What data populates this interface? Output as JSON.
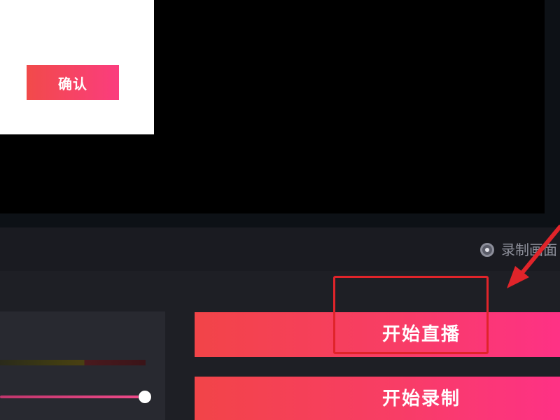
{
  "dialog": {
    "confirm_label": "确认"
  },
  "status_bar": {
    "record_option_label": "录制画面"
  },
  "controls": {
    "start_live_label": "开始直播",
    "start_record_label": "开始录制"
  },
  "audio": {
    "volume_percent": 100
  },
  "colors": {
    "accent_start": "#f24448",
    "accent_end": "#fe3186",
    "annotation_red": "#e0242a",
    "preview_bg": "#000000",
    "panel_bg": "#1e1f25"
  },
  "icons": {
    "record_option": "radio-icon",
    "annotation": "arrow-icon"
  }
}
